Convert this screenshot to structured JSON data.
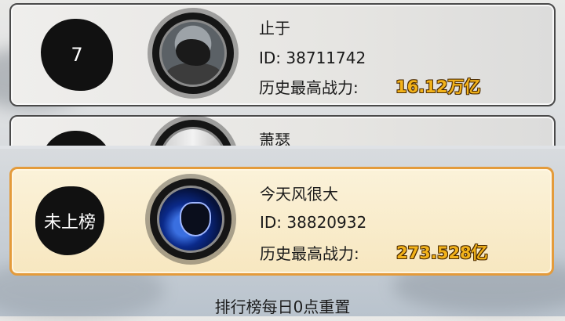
{
  "ranking_list": [
    {
      "rank": "7",
      "name": "止于",
      "id_text": "ID: 38711742",
      "power_label": "历史最高战力:",
      "power_value": "16.12万亿",
      "avatar_icon": "dark-rock-avatar"
    },
    {
      "rank": "",
      "name": "萧瑟",
      "avatar_icon": "light-avatar"
    }
  ],
  "my_entry": {
    "rank": "未上榜",
    "name": "今天风很大",
    "id_text": "ID: 38820932",
    "power_label": "历史最高战力:",
    "power_value": "273.528亿",
    "avatar_icon": "ninja-avatar"
  },
  "footer_note": "排行榜每日0点重置",
  "colors": {
    "my_card_border": "#e49b3b",
    "power_value": "#f2b21a"
  }
}
